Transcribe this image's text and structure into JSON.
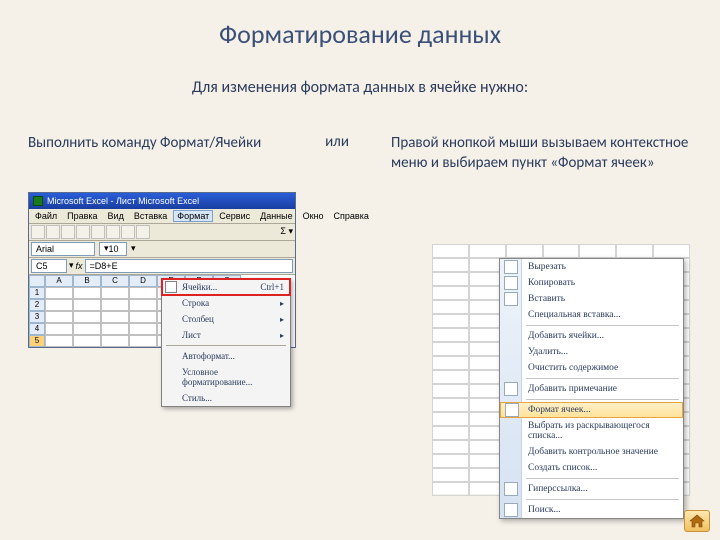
{
  "title": "Форматирование данных",
  "subtitle": "Для изменения формата данных в ячейке нужно:",
  "left_text": "Выполнить команду Формат/Ячейки",
  "middle": "или",
  "right_text": "Правой кнопкой мыши вызываем контекстное меню и выбираем пункт «Формат ячеек»",
  "excel": {
    "app_title": "Microsoft Excel - Лист Microsoft Excel",
    "menubar": [
      "Файл",
      "Правка",
      "Вид",
      "Вставка",
      "Формат",
      "Сервис",
      "Данные",
      "Окно",
      "Справка"
    ],
    "active_menu_index": 4,
    "font_name": "Arial",
    "font_size": "10",
    "cell_ref": "C5",
    "formula": "=D8+E",
    "col_headers": [
      "A",
      "B",
      "C",
      "D",
      "E",
      "F",
      "G"
    ],
    "rows": [
      "1",
      "2",
      "3",
      "4",
      "5"
    ],
    "selected_row": "5",
    "dropdown": [
      {
        "label": "Ячейки...",
        "shortcut": "Ctrl+1",
        "icon": true,
        "hl": true
      },
      {
        "label": "Строка",
        "sub": true
      },
      {
        "label": "Столбец",
        "sub": true
      },
      {
        "label": "Лист",
        "sub": true
      },
      {
        "sep": true
      },
      {
        "label": "Автоформат..."
      },
      {
        "label": "Условное форматирование..."
      },
      {
        "label": "Стиль..."
      }
    ]
  },
  "context_menu": [
    {
      "label": "Вырезать",
      "icon": true
    },
    {
      "label": "Копировать",
      "icon": true
    },
    {
      "label": "Вставить",
      "icon": true
    },
    {
      "label": "Специальная вставка..."
    },
    {
      "sep": true
    },
    {
      "label": "Добавить ячейки..."
    },
    {
      "label": "Удалить..."
    },
    {
      "label": "Очистить содержимое"
    },
    {
      "sep": true
    },
    {
      "label": "Добавить примечание",
      "icon": true
    },
    {
      "sep": true
    },
    {
      "label": "Формат ячеек...",
      "icon": true,
      "sel": true
    },
    {
      "label": "Выбрать из раскрывающегося списка..."
    },
    {
      "label": "Добавить контрольное значение"
    },
    {
      "label": "Создать список..."
    },
    {
      "sep": true
    },
    {
      "label": "Гиперссылка...",
      "icon": true
    },
    {
      "sep": true
    },
    {
      "label": "Поиск...",
      "icon": true
    }
  ]
}
